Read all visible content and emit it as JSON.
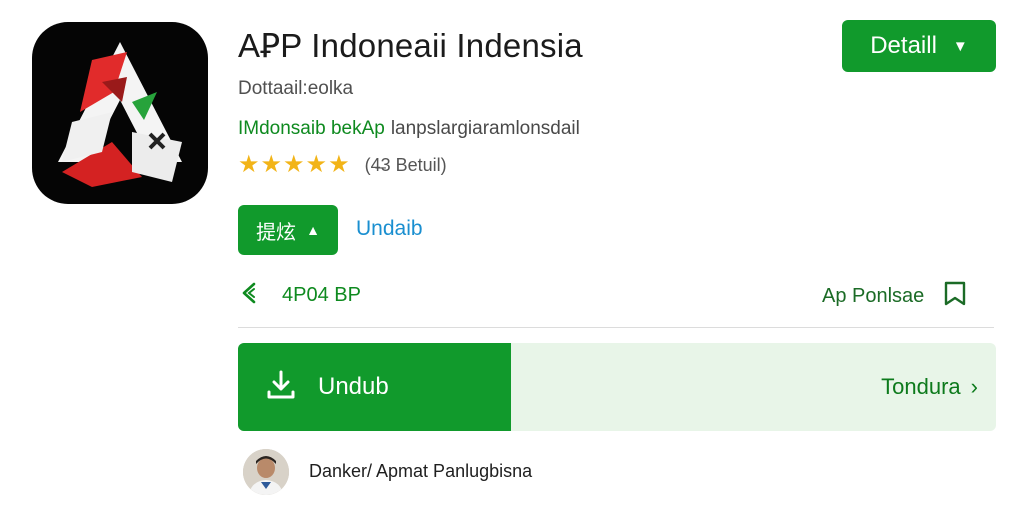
{
  "app": {
    "title": "AꝐP Indoneaii Indensia",
    "developer": "Dottaail:eolka",
    "tagline_green": "IMdonsaib bekAp",
    "tagline_gray": "lanpslargiaramlonsdail",
    "rating_stars": 5,
    "rating_text": "(4̶3 Betuil)",
    "icon_name": "app-logo-icon"
  },
  "header": {
    "detail_button": "Detaill",
    "detail_icon": "chevron-down-icon"
  },
  "actions": {
    "install_button": "提炫",
    "install_icon": "arrow-up-icon",
    "undab_link": "Undaib",
    "share_label": "4P04 BP",
    "share_icon": "share-icon",
    "save_label": "Ap Ponlsae",
    "save_icon": "bookmark-icon"
  },
  "download": {
    "label": "Undub",
    "icon": "download-icon",
    "right_label": "Tondura",
    "right_icon": "chevron-right-icon",
    "progress": 0.36
  },
  "review": {
    "author": "Danker/ Apmat Panlugbisna",
    "avatar_icon": "avatar"
  },
  "colors": {
    "accent": "#119a2c",
    "accent_light": "#e8f5e8",
    "star": "#f2b418",
    "link": "#1a8fd0"
  }
}
